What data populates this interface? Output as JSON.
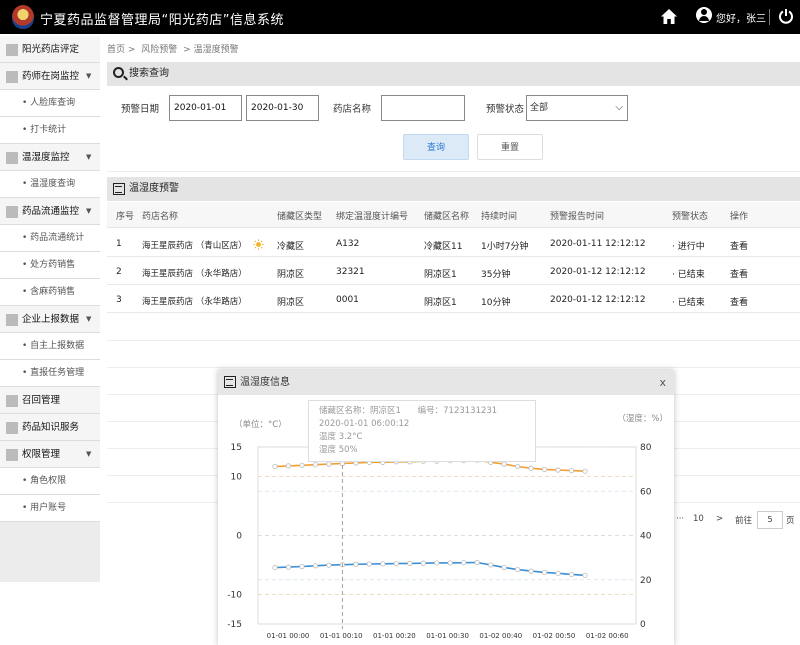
{
  "app": {
    "title": "宁夏药品监督管理局“阳光药店”信息系统",
    "greeting": "您好，张三",
    "icons": [
      "logo-badge",
      "home-icon",
      "user-icon",
      "power-icon"
    ]
  },
  "sidebar": {
    "items": [
      {
        "label": "阳光药店评定",
        "type": "top"
      },
      {
        "label": "药师在岗监控",
        "type": "top",
        "arrow": "▼"
      },
      {
        "label": "• 人脸库查询",
        "type": "sub"
      },
      {
        "label": "• 打卡统计",
        "type": "sub"
      },
      {
        "label": "温湿度监控",
        "type": "top",
        "arrow": "▼"
      },
      {
        "label": "• 温湿度查询",
        "type": "sub"
      },
      {
        "label": "药品流通监控",
        "type": "top",
        "arrow": "▼"
      },
      {
        "label": "• 药品流通统计",
        "type": "sub"
      },
      {
        "label": "• 处方药销售",
        "type": "sub"
      },
      {
        "label": "• 含麻药销售",
        "type": "sub"
      },
      {
        "label": "企业上报数据",
        "type": "top",
        "arrow": "▼"
      },
      {
        "label": "• 自主上报数据",
        "type": "sub"
      },
      {
        "label": "• 直报任务管理",
        "type": "sub"
      },
      {
        "label": "召回管理",
        "type": "top"
      },
      {
        "label": "药品知识服务",
        "type": "top"
      },
      {
        "label": "权限管理",
        "type": "top",
        "arrow": "▼"
      },
      {
        "label": "• 角色权限",
        "type": "sub"
      },
      {
        "label": "• 用户账号",
        "type": "sub"
      }
    ]
  },
  "breadcrumb": [
    "首页 >",
    "风险预警",
    "> 温湿度预警"
  ],
  "search": {
    "title": "搜索查询",
    "date_label": "预警日期",
    "date_from": "2020-01-01",
    "date_to": "2020-01-30",
    "store_label": "药店名称",
    "store_value": "",
    "status_label": "预警状态",
    "status_value": "全部",
    "query_btn": "查询",
    "reset_btn": "重置"
  },
  "table": {
    "title": "温湿度预警",
    "headers": [
      "序号",
      "药店名称",
      "储藏区类型",
      "绑定温湿度计编号",
      "储藏区名称",
      "持续时间",
      "预警报告时间",
      "预警状态",
      "操作"
    ],
    "rows": [
      {
        "no": "1",
        "store": "海王星辰药店 （青山区店）",
        "zone_type": "冷藏区",
        "meter": "A132",
        "zone": "冷藏区11",
        "duration": "1小时7分钟",
        "time": "2020-01-11  12:12:12",
        "status": "· 进行中",
        "status_kind": "active",
        "action": "查看",
        "has_sun": true
      },
      {
        "no": "2",
        "store": "海王星辰药店 （永华路店）",
        "zone_type": "阴凉区",
        "meter": "32321",
        "zone": "阴凉区1",
        "duration": "35分钟",
        "time": "2020-01-12  12:12:12",
        "status": "· 已结束",
        "status_kind": "done",
        "action": "查看",
        "has_sun": false
      },
      {
        "no": "3",
        "store": "海王星辰药店 （永华路店）",
        "zone_type": "阴凉区",
        "meter": "0001",
        "zone": "阴凉区1",
        "duration": "10分钟",
        "time": "2020-01-12  12:12:12",
        "status": "· 已结束",
        "status_kind": "done",
        "action": "查看",
        "has_sun": false
      }
    ]
  },
  "pager": {
    "ellipsis": "···",
    "last_page": "10",
    "next": ">",
    "goto_label": "前往",
    "goto_value": "5",
    "page_unit": "页"
  },
  "modal": {
    "title": "温湿度信息",
    "close": "x",
    "unit_left": "（单位：°C）",
    "unit_right": "（湿度：%）",
    "tooltip": {
      "zone": "储藏区名称：阴凉区1",
      "code": "编号：7123131231",
      "time": "2020-01-01    06:00:12",
      "temp": "温度    3.2°C",
      "humidity": "湿度    50%"
    }
  },
  "chart_data": {
    "type": "line",
    "x": [
      "01-01 00:00",
      "01-01 00:10",
      "01-01 00:20",
      "01-01 00:30",
      "01-02 00:40",
      "01-02 00:50",
      "01-02 00:60"
    ],
    "left_ticks": [
      15,
      10,
      0,
      -10,
      -15
    ],
    "right_ticks": [
      80,
      60,
      40,
      20,
      0
    ],
    "left_range": [
      -15,
      15
    ],
    "right_range": [
      0,
      80
    ],
    "series": [
      {
        "axis": "left",
        "color": "#f0a030",
        "values": [
          11.7,
          11.8,
          11.9,
          12.0,
          12.1,
          12.2,
          12.3,
          12.4,
          12.4,
          12.5,
          12.5,
          12.6,
          12.6,
          12.7,
          12.7,
          12.8,
          12.4,
          12.1,
          11.7,
          11.4,
          11.2,
          11.1,
          11.0,
          10.9
        ]
      },
      {
        "axis": "right",
        "color": "#3a8fd6",
        "values": [
          25.5,
          25.7,
          26.0,
          26.3,
          26.6,
          26.8,
          27.0,
          27.1,
          27.2,
          27.3,
          27.4,
          27.5,
          27.6,
          27.6,
          27.7,
          27.8,
          26.7,
          25.6,
          24.6,
          23.9,
          23.3,
          22.9,
          22.4,
          22.0
        ]
      }
    ],
    "tooltip_index": 5,
    "grid": "dashed"
  }
}
